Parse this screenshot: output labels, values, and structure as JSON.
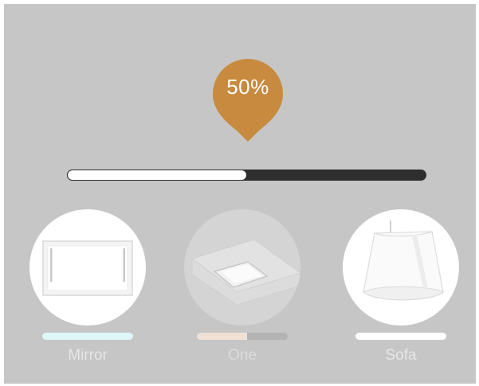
{
  "brightness": {
    "label": "50%",
    "value_fraction": 0.5,
    "pin_color": "#c88a3e"
  },
  "lamps": [
    {
      "name": "Mirror",
      "icon": "mirror-lamp-icon",
      "active": true,
      "bar_fraction": 1.0,
      "bar_color": "#dcf7f6"
    },
    {
      "name": "One",
      "icon": "ceiling-panel-icon",
      "active": false,
      "bar_fraction": 0.55,
      "bar_color": "#f1e1d5"
    },
    {
      "name": "Sofa",
      "icon": "floor-lamp-shade-icon",
      "active": true,
      "bar_fraction": 1.0,
      "bar_color": "#ffffff"
    }
  ]
}
